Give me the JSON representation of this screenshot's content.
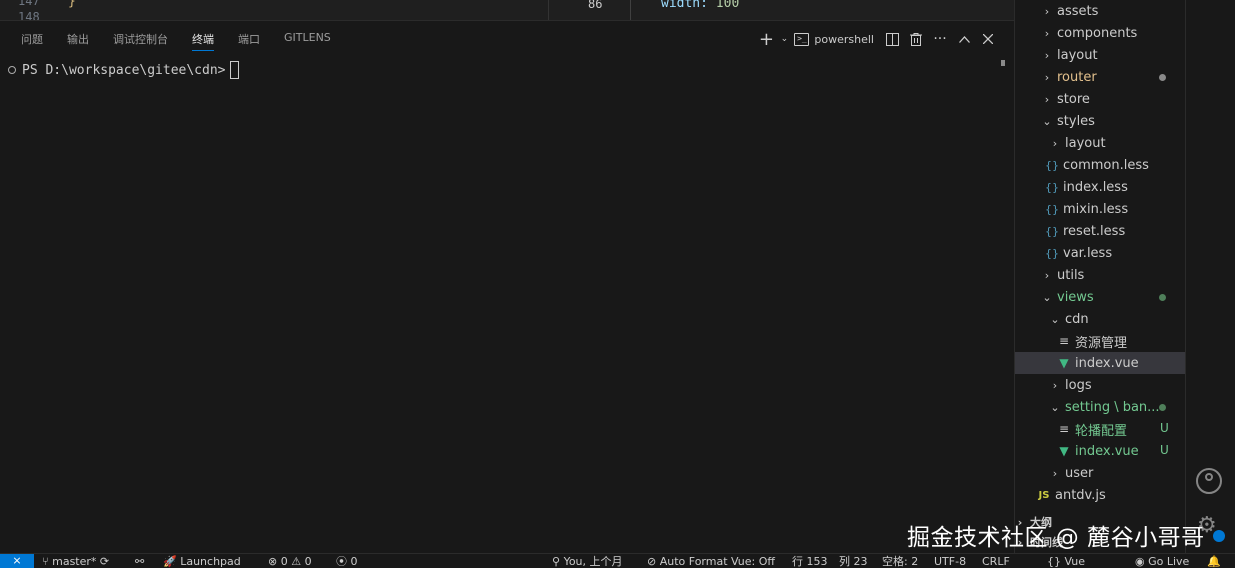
{
  "editor": {
    "left_line_1": "147",
    "left_line_2": "148",
    "left_brace": "}",
    "right_line": "86",
    "right_code_prop": "width:",
    "right_code_val": "100"
  },
  "panel": {
    "tabs": [
      "问题",
      "输出",
      "调试控制台",
      "终端",
      "端口",
      "GITLENS"
    ],
    "active_tab": "终端",
    "shell_name": "powershell",
    "prompt": "PS D:\\workspace\\gitee\\cdn>"
  },
  "explorer": {
    "items": [
      {
        "label": "assets",
        "kind": "folder-closed"
      },
      {
        "label": "components",
        "kind": "folder-closed"
      },
      {
        "label": "layout",
        "kind": "folder-closed"
      },
      {
        "label": "router",
        "kind": "folder-closed",
        "status": "modified"
      },
      {
        "label": "store",
        "kind": "folder-closed"
      },
      {
        "label": "styles",
        "kind": "folder-open"
      },
      {
        "label": "layout",
        "kind": "folder-closed"
      },
      {
        "label": "common.less",
        "kind": "less"
      },
      {
        "label": "index.less",
        "kind": "less"
      },
      {
        "label": "mixin.less",
        "kind": "less"
      },
      {
        "label": "reset.less",
        "kind": "less"
      },
      {
        "label": "var.less",
        "kind": "less"
      },
      {
        "label": "utils",
        "kind": "folder-closed"
      },
      {
        "label": "views",
        "kind": "folder-open",
        "status": "untracked-folder"
      },
      {
        "label": "cdn",
        "kind": "folder-open"
      },
      {
        "label": "资源管理",
        "kind": "text"
      },
      {
        "label": "index.vue",
        "kind": "vue",
        "selected": true
      },
      {
        "label": "logs",
        "kind": "folder-closed"
      },
      {
        "label": "setting \\ ban...",
        "kind": "folder-open",
        "status": "untracked-folder"
      },
      {
        "label": "轮播配置",
        "kind": "text",
        "status": "untracked",
        "badge": "U"
      },
      {
        "label": "index.vue",
        "kind": "vue",
        "status": "untracked",
        "badge": "U"
      },
      {
        "label": "user",
        "kind": "folder-closed"
      },
      {
        "label": "antdv.js",
        "kind": "js"
      }
    ],
    "sections": [
      "大纲",
      "时间线"
    ]
  },
  "statusbar": {
    "branch": "master*",
    "launchpad": "Launchpad",
    "problems": "0",
    "warnings": "0",
    "ports": "0",
    "blame": "You, 上个月",
    "auto_format": "Auto Format Vue: Off",
    "line": "行 153",
    "col": "列 23",
    "spaces": "空格: 2",
    "encoding": "UTF-8",
    "eol": "CRLF",
    "language": "Vue",
    "golive": "Go Live"
  },
  "watermark": "掘金技术社区 @ 麓谷小哥哥",
  "colors": {
    "accent": "#0078d4",
    "modified": "#e2c08d",
    "untracked": "#73c991",
    "vue": "#41b883"
  }
}
